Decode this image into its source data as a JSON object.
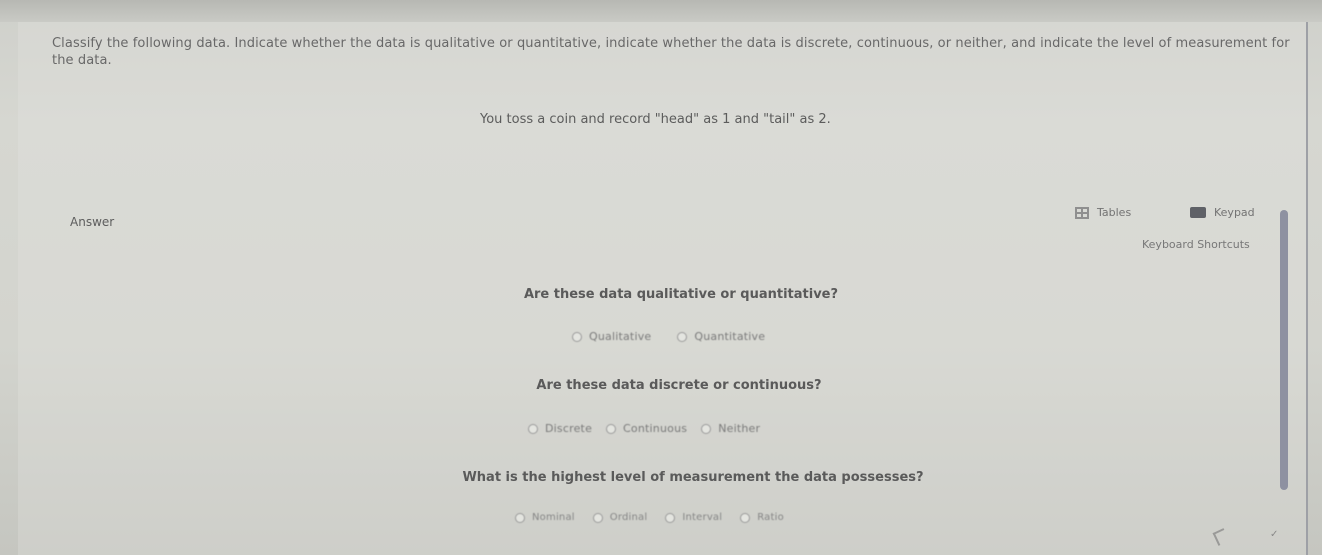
{
  "header": {
    "question_text": "Classify the following data. Indicate whether the data is qualitative or quantitative, indicate whether the data is discrete, continuous, or neither, and indicate the level of measurement for the data."
  },
  "scenario": {
    "text": "You toss a coin and record \"head\" as 1 and \"tail\" as 2."
  },
  "answer": {
    "label": "Answer"
  },
  "tools": {
    "tables_label": "Tables",
    "keypad_label": "Keypad",
    "shortcuts_label": "Keyboard Shortcuts"
  },
  "questions": [
    {
      "prompt": "Are these data qualitative or quantitative?",
      "options": [
        "Qualitative",
        "Quantitative"
      ]
    },
    {
      "prompt": "Are these data discrete or continuous?",
      "options": [
        "Discrete",
        "Continuous",
        "Neither"
      ]
    },
    {
      "prompt": "What is the highest level of measurement the data possesses?",
      "options": [
        "Nominal",
        "Ordinal",
        "Interval",
        "Ratio"
      ]
    }
  ],
  "icons": {
    "tables": "table-icon",
    "keypad": "keypad-icon",
    "radio": "radio-icon",
    "cursor": "pointer-icon"
  },
  "colors": {
    "background": "#d3d4ce",
    "scrollbar": "#8e91a1",
    "text": "#5a5a5a"
  }
}
